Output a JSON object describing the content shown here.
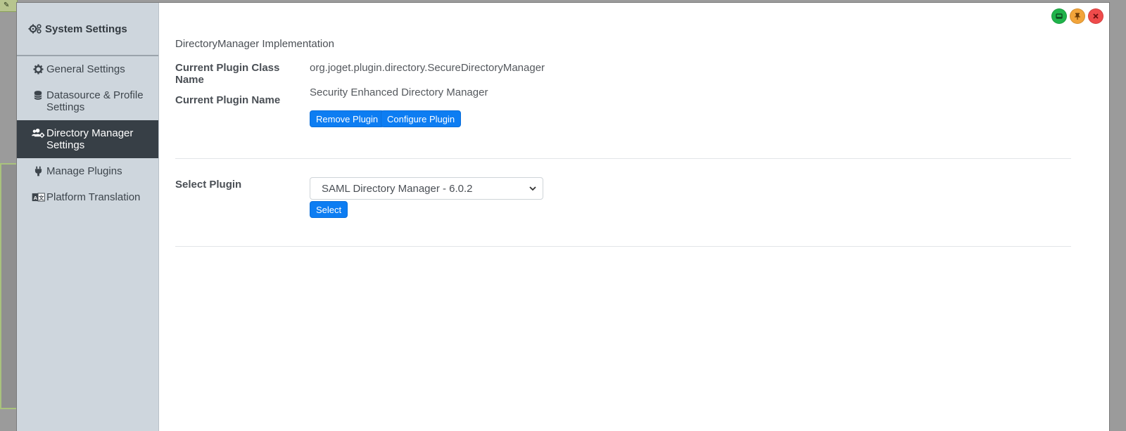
{
  "modal": {
    "controls": [
      {
        "name": "minimize-window-button",
        "icon": "minimize-icon",
        "color": "#1fb34a"
      },
      {
        "name": "pin-window-button",
        "icon": "pin-icon",
        "color": "#f2a43a"
      },
      {
        "name": "close-window-button",
        "icon": "close-icon",
        "color": "#ef4b4b"
      }
    ]
  },
  "sidebar": {
    "title": "System Settings",
    "title_icon": "gears-icon",
    "items": [
      {
        "label": "General Settings",
        "icon": "gear-icon",
        "active": false
      },
      {
        "label": "Datasource & Profile Settings",
        "icon": "database-icon",
        "active": false
      },
      {
        "label": "Directory Manager Settings",
        "icon": "users-cog-icon",
        "active": true
      },
      {
        "label": "Manage Plugins",
        "icon": "plug-icon",
        "active": false
      },
      {
        "label": "Platform Translation",
        "icon": "language-icon",
        "active": false
      }
    ],
    "background": "#ced6dd",
    "active_background": "#373f46"
  },
  "main": {
    "section_title": "DirectoryManager Implementation",
    "current_plugin_class_label": "Current Plugin Class Name",
    "current_plugin_class_value": "org.joget.plugin.directory.SecureDirectoryManager",
    "current_plugin_name_label": "Current Plugin Name",
    "current_plugin_name_value": "Security Enhanced Directory Manager",
    "remove_plugin_button": "Remove Plugin",
    "configure_plugin_button": "Configure Plugin",
    "select_plugin_label": "Select Plugin",
    "select_plugin_value": "SAML Directory Manager - 6.0.2",
    "select_button": "Select",
    "accent_color": "#0d7df2"
  }
}
